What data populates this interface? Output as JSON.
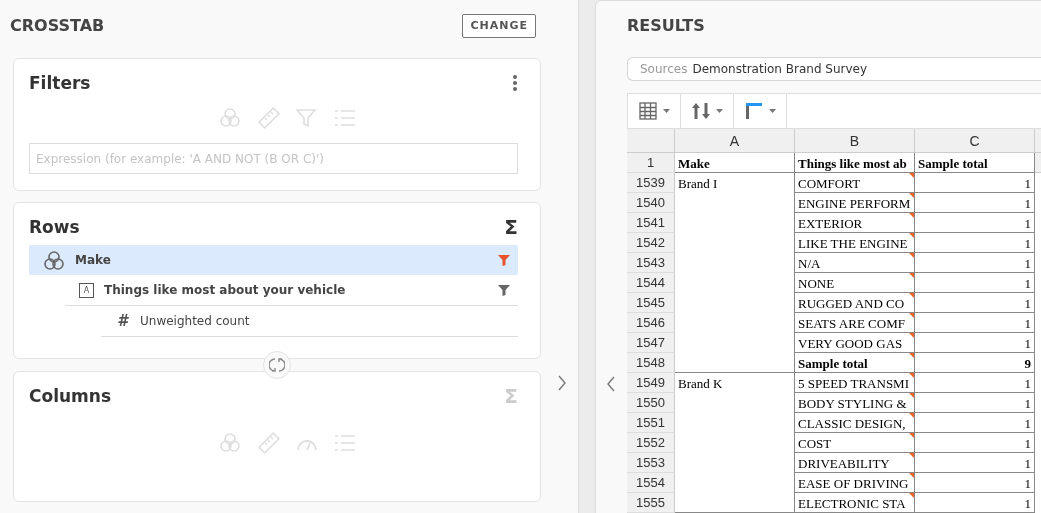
{
  "crosstab": {
    "title": "CROSSTAB",
    "change_button": "CHANGE",
    "filters": {
      "title": "Filters",
      "placeholder": "Expression (for example: 'A AND NOT (B OR C)')"
    },
    "rows": {
      "title": "Rows",
      "sigma": "Σ",
      "sigma_enabled": true,
      "items": [
        {
          "kind": "category",
          "label": "Make",
          "selected": true,
          "filter_active": true,
          "children": [
            {
              "kind": "text",
              "label": "Things like most about your vehicle",
              "type_letter": "A",
              "selected": false,
              "filter_active": false,
              "children": [
                {
                  "kind": "number",
                  "label": "Unweighted count",
                  "symbol": "#",
                  "selected": false
                }
              ]
            }
          ]
        }
      ]
    },
    "columns": {
      "title": "Columns",
      "sigma": "Σ",
      "sigma_enabled": false
    }
  },
  "results": {
    "title": "RESULTS",
    "sources_label": "Sources",
    "sources_value": "Demonstration Brand Survey",
    "table": {
      "columns": [
        "A",
        "B",
        "C"
      ],
      "header": {
        "number": "1",
        "cells": [
          "Make",
          "Things like most ab",
          "Sample total"
        ]
      },
      "groups": [
        {
          "make": "Brand I",
          "rows": [
            {
              "number": "1539",
              "answer": "COMFORT",
              "total": "1",
              "bold": false,
              "comment": true
            },
            {
              "number": "1540",
              "answer": "ENGINE PERFORM",
              "total": "1",
              "bold": false,
              "comment": true
            },
            {
              "number": "1541",
              "answer": "EXTERIOR",
              "total": "1",
              "bold": false,
              "comment": true
            },
            {
              "number": "1542",
              "answer": "LIKE THE ENGINE",
              "total": "1",
              "bold": false,
              "comment": true
            },
            {
              "number": "1543",
              "answer": "N/A",
              "total": "1",
              "bold": false,
              "comment": true
            },
            {
              "number": "1544",
              "answer": "NONE",
              "total": "1",
              "bold": false,
              "comment": true
            },
            {
              "number": "1545",
              "answer": "RUGGED AND CO",
              "total": "1",
              "bold": false,
              "comment": true
            },
            {
              "number": "1546",
              "answer": "SEATS ARE COMF",
              "total": "1",
              "bold": false,
              "comment": true
            },
            {
              "number": "1547",
              "answer": "VERY GOOD GAS",
              "total": "1",
              "bold": false,
              "comment": true
            },
            {
              "number": "1548",
              "answer": "Sample total",
              "total": "9",
              "bold": true,
              "comment": true
            }
          ]
        },
        {
          "make": "Brand K",
          "rows": [
            {
              "number": "1549",
              "answer": "5 SPEED TRANSMI",
              "total": "1",
              "bold": false,
              "comment": true
            },
            {
              "number": "1550",
              "answer": "BODY STYLING &",
              "total": "1",
              "bold": false,
              "comment": true
            },
            {
              "number": "1551",
              "answer": "CLASSIC DESIGN,",
              "total": "1",
              "bold": false,
              "comment": true
            },
            {
              "number": "1552",
              "answer": "COST",
              "total": "1",
              "bold": false,
              "comment": true
            },
            {
              "number": "1553",
              "answer": "DRIVEABILITY",
              "total": "1",
              "bold": false,
              "comment": true
            },
            {
              "number": "1554",
              "answer": "EASE OF DRIVING",
              "total": "1",
              "bold": false,
              "comment": true
            },
            {
              "number": "1555",
              "answer": "ELECTRONIC STA",
              "total": "1",
              "bold": false,
              "comment": true
            }
          ]
        }
      ]
    }
  }
}
